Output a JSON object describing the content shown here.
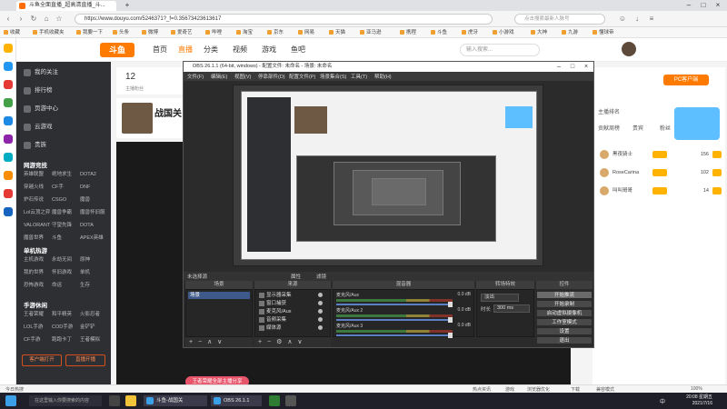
{
  "browser": {
    "tab_title": "斗鱼全面直播_超高清直播_斗...",
    "new_tab": "+",
    "url": "https://www.douyu.com/5246371?_f=0.35673423613617",
    "search_placeholder": "点击搜索最新人脉号",
    "bookmarks": [
      "收藏",
      "手机收藏夹",
      "我要一下",
      "头条",
      "微博",
      "爱奇艺",
      "哔哩",
      "淘宝",
      "京东",
      "网易",
      "天猫",
      "亚马逊",
      "携程",
      "斗鱼",
      "虎牙",
      "小游戏",
      "大神",
      "九游",
      "懂球帝"
    ]
  },
  "douyu": {
    "logo": "斗鱼",
    "nav": [
      "首页",
      "直播",
      "分类",
      "视频",
      "游戏",
      "鱼吧"
    ],
    "search_placeholder": "输入搜索...",
    "pc_client": "PC客户端",
    "sidebar": {
      "top_items": [
        "我的关注",
        "排行榜",
        "页游中心",
        "云游戏"
      ],
      "vip": "贵族",
      "sections": [
        {
          "title": "网游竞技",
          "items": [
            "英雄联盟",
            "绝地求生",
            "DOTA2",
            "穿越火线",
            "CF手",
            "DNF",
            "炉石传说",
            "CSGO",
            "魔兽",
            "Lol云顶之弈",
            "魔兽争霸",
            "魔兽怀旧服",
            "VALORANT",
            "守望先锋",
            "DOTA",
            "魔兽世界",
            "斗鱼",
            "APEX英雄"
          ]
        },
        {
          "title": "单机热游",
          "items": [
            "主机游戏",
            "永劫无间",
            "原神",
            "我的世界",
            "怀旧游戏",
            "单机",
            "恐怖游戏",
            "命运",
            "生存"
          ]
        },
        {
          "title": "手游休闲",
          "items": [
            "王者荣耀",
            "和平精英",
            "火影忍者",
            "LOL手游",
            "COD手游",
            "金铲铲",
            "CF手游",
            "跑跑卡丁",
            "王者模拟"
          ]
        }
      ],
      "buttons": [
        "客户端打开",
        "直播开播"
      ]
    },
    "info": {
      "count": "12",
      "label": "主播粉丝"
    },
    "streamer_name": "战国关",
    "gift_text": "王者荣耀全部主播分享",
    "right": {
      "tabs": [
        "主播排名",
        "贡献周榜",
        "贵宾",
        "粉丝"
      ],
      "ranks": [
        {
          "name": "黑夜骑士",
          "count": "156"
        },
        {
          "name": "RoseCarina",
          "count": "102"
        },
        {
          "name": "叫叫哥哥",
          "count": "14"
        }
      ]
    }
  },
  "obs": {
    "title": "OBS 26.1.1 (64-bit, windows) - 配置文件: 未命名 - 场景: 未命名",
    "menu": [
      "文件(F)",
      "编辑(E)",
      "视图(V)",
      "停靠部件(D)",
      "配置文件(P)",
      "场景集合(S)",
      "工具(T)",
      "帮助(H)"
    ],
    "section_labels": [
      "未选择源",
      "属性",
      "滤镜"
    ],
    "panels": [
      "场景",
      "来源",
      "混音器",
      "转场特效",
      "控件"
    ],
    "scene": "场景",
    "sources": [
      "显示器采集",
      "窗口捕获",
      "麦克风/Aux",
      "音频采集",
      "媒体源"
    ],
    "mixer": [
      {
        "label": "麦克风/Aux",
        "db": "0.0 dB"
      },
      {
        "label": "麦克风/Aux 2",
        "db": "0.0 dB"
      },
      {
        "label": "麦克风/Aux 3",
        "db": "0.0 dB"
      }
    ],
    "transition": {
      "type": "淡出",
      "duration_label": "时长",
      "duration": "300 ms"
    },
    "controls": [
      "开始推流",
      "开始录制",
      "启动虚拟摄像机",
      "工作室模式",
      "设置",
      "退出"
    ]
  },
  "statusbar": [
    "今日热搜",
    "热点资讯",
    "游戏",
    "浏览器优化",
    "下载",
    "兼容模式",
    "100%"
  ],
  "taskbar": {
    "search": "在这里输入你要搜索的内容",
    "apps": [
      "斗鱼-战国关",
      "OBS 26.1.1"
    ],
    "time": "20:08 星期五",
    "date": "2021/7/16",
    "lang": "中"
  },
  "colors": {
    "accent": "#ff7a00",
    "obs_bg": "#2b2b2b",
    "sidebar": "#2e2f33"
  }
}
